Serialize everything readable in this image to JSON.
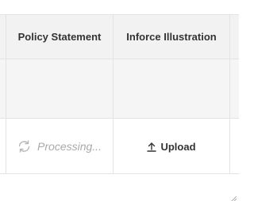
{
  "table": {
    "columns": [
      {
        "label": "Policy Statement"
      },
      {
        "label": "Inforce Illustration"
      }
    ],
    "rows": [
      {
        "policy_statement": {
          "icon": "refresh-icon",
          "status": "Processing..."
        },
        "inforce_illustration": {
          "icon": "upload-icon",
          "action": "Upload"
        }
      }
    ]
  },
  "colors": {
    "header_bg": "#f2f2f2",
    "empty_row_bg": "#f5f5f5",
    "border": "#e3e3e3",
    "text": "#333333",
    "muted_text": "#a9a9a9"
  }
}
